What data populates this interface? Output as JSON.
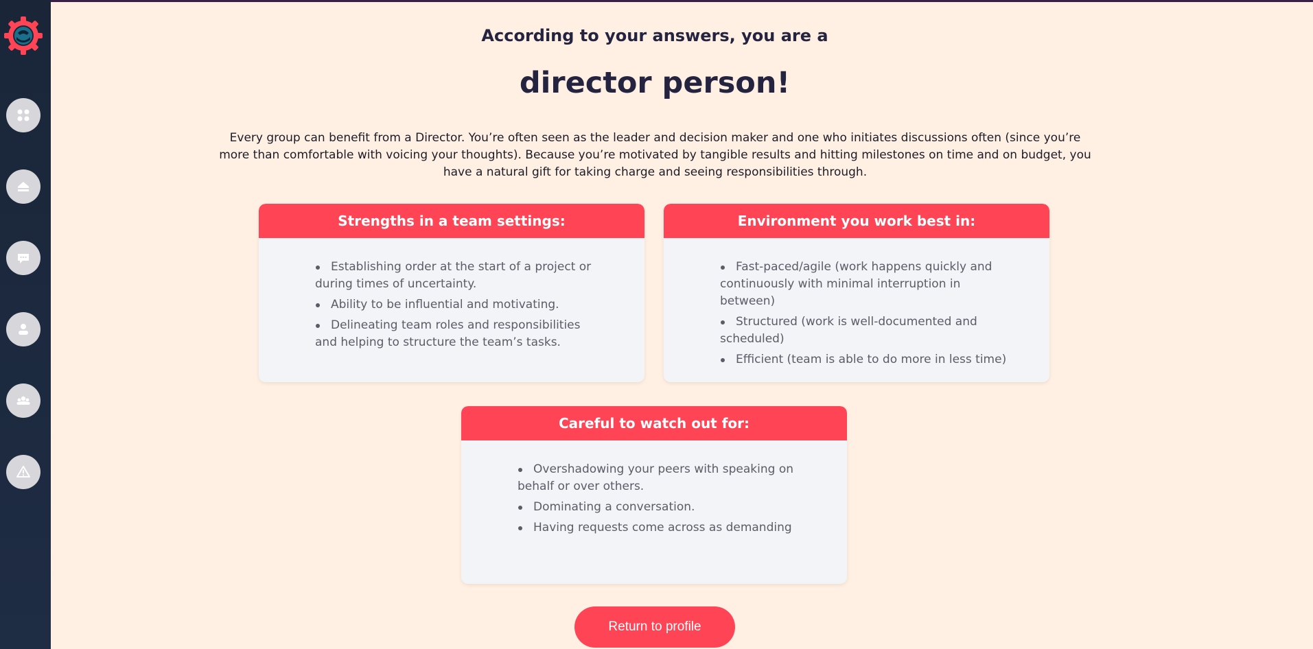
{
  "header": {
    "pre_title": "According to your answers, you are a",
    "title": "director person!"
  },
  "description": "Every group can benefit from a Director. You’re often seen as the leader and decision maker and one who initiates discussions often (since you’re more than comfortable with voicing your thoughts). Because you’re motivated by tangible results and hitting milestones on time and on budget, you have a natural gift for taking charge and seeing responsibilities through.",
  "sidebar": {
    "items": [
      {
        "icon": "apps-icon"
      },
      {
        "icon": "home-icon"
      },
      {
        "icon": "chat-icon"
      },
      {
        "icon": "user-icon"
      },
      {
        "icon": "team-icon"
      },
      {
        "icon": "warning-icon"
      }
    ]
  },
  "cards": {
    "strengths": {
      "title": "Strengths in a team settings:",
      "items": [
        "Establishing order at the start of a project or during times of uncertainty.",
        "Ability to be influential and motivating.",
        "Delineating team roles and responsibilities and helping to structure the team’s tasks."
      ]
    },
    "environment": {
      "title": "Environment you work best in:",
      "items": [
        "Fast-paced/agile (work happens quickly and continuously with minimal interruption in between)",
        "Structured (work is well-documented and scheduled)",
        "Efficient (team is able to do more in less time)"
      ]
    },
    "watch_out": {
      "title": "Careful to watch out for:",
      "items": [
        "Overshadowing your peers with speaking on behalf or over others.",
        "Dominating a conversation.",
        "Having requests come across as demanding"
      ]
    }
  },
  "actions": {
    "return_label": "Return to profile"
  },
  "colors": {
    "accent": "#ff4455",
    "background": "#fff0e3",
    "sidebar": "#1a2638",
    "text_dark": "#252440"
  }
}
